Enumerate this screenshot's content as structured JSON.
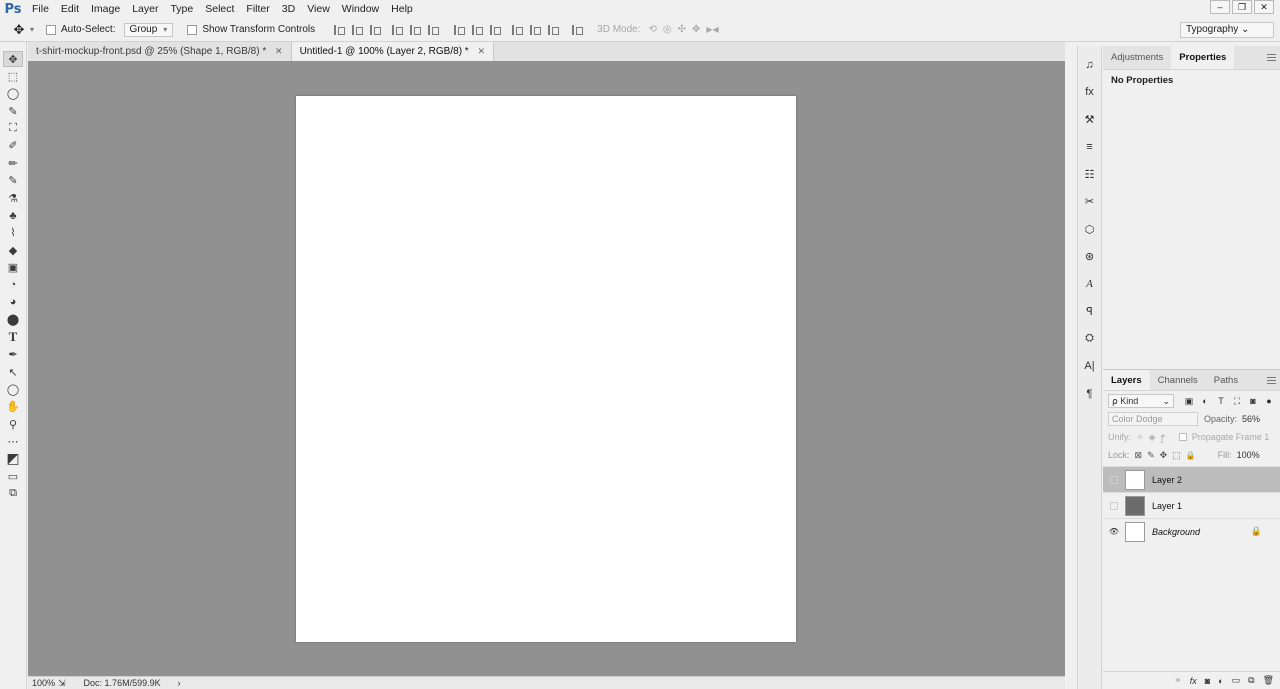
{
  "app": {
    "logo": "Ps"
  },
  "menu": [
    "File",
    "Edit",
    "Image",
    "Layer",
    "Type",
    "Select",
    "Filter",
    "3D",
    "View",
    "Window",
    "Help"
  ],
  "window_controls": {
    "minimize": "–",
    "restore": "❐",
    "close": "✕"
  },
  "options_bar": {
    "move_icon": "✥",
    "dropdown_arrow": "▾",
    "auto_select_label": "Auto-Select:",
    "auto_select_value": "Group",
    "transform_label": "Show Transform Controls",
    "mode_label": "3D Mode:",
    "mode_icons": [
      "⟲",
      "◎",
      "✣",
      "✥",
      "▶◀"
    ],
    "workspace": "Typography ⌄"
  },
  "tabs": [
    {
      "label": "t-shirt-mockup-front.psd @ 25% (Shape 1, RGB/8) *",
      "close": "✕"
    },
    {
      "label": "Untitled-1 @ 100% (Layer 2, RGB/8) *",
      "close": "✕"
    }
  ],
  "tools": [
    "✥",
    "⬚",
    "◯",
    "✎",
    "⛶",
    "✐",
    "✏",
    "✎",
    "⚗",
    "♣",
    "⌇",
    "◆",
    "▣",
    "◔",
    "◕",
    "⬤",
    "T",
    "✒",
    "↖",
    "◯",
    "✋",
    "⚲",
    "⋯",
    "◩",
    "▭",
    "⧉"
  ],
  "status": {
    "zoom": "100%",
    "doc_icon": "⇲",
    "doc": "Doc: 1.76M/599.9K",
    "arrow": "›"
  },
  "dock_icons": [
    "♫",
    "fx",
    "⚒",
    "≡",
    "☷",
    "✂",
    "⬡",
    "⊛",
    "A",
    "ꟼ",
    "⛭",
    "A|",
    "¶"
  ],
  "properties_panel": {
    "tabs": [
      "Adjustments",
      "Properties"
    ],
    "empty_text": "No Properties"
  },
  "layers_panel": {
    "tabs": [
      "Layers",
      "Channels",
      "Paths"
    ],
    "kind_label": "⍴ Kind",
    "kind_arrow": "⌄",
    "filter_icons": [
      "▣",
      "◐",
      "T",
      "⛶",
      "◙",
      "●"
    ],
    "blend_mode": "Color Dodge",
    "opacity_label": "Opacity:",
    "opacity_value": "56%",
    "unify_label": "Unify:",
    "unify_icons": [
      "✧",
      "◈",
      "ꝭ"
    ],
    "propagate_label": "Propagate Frame 1",
    "lock_label": "Lock:",
    "lock_icons": [
      "⊠",
      "✎",
      "✥",
      "⬚",
      "🔒"
    ],
    "fill_label": "Fill:",
    "fill_value": "100%",
    "layers": [
      {
        "name": "Layer 2",
        "visible": false
      },
      {
        "name": "Layer 1",
        "visible": false
      },
      {
        "name": "Background",
        "visible": true,
        "locked": true
      }
    ],
    "eye_icon": "👁",
    "lock_icon": "🔒",
    "footer_icons": [
      "⚭",
      "fx",
      "◙",
      "◐",
      "▭",
      "⧉",
      "🗑"
    ]
  }
}
